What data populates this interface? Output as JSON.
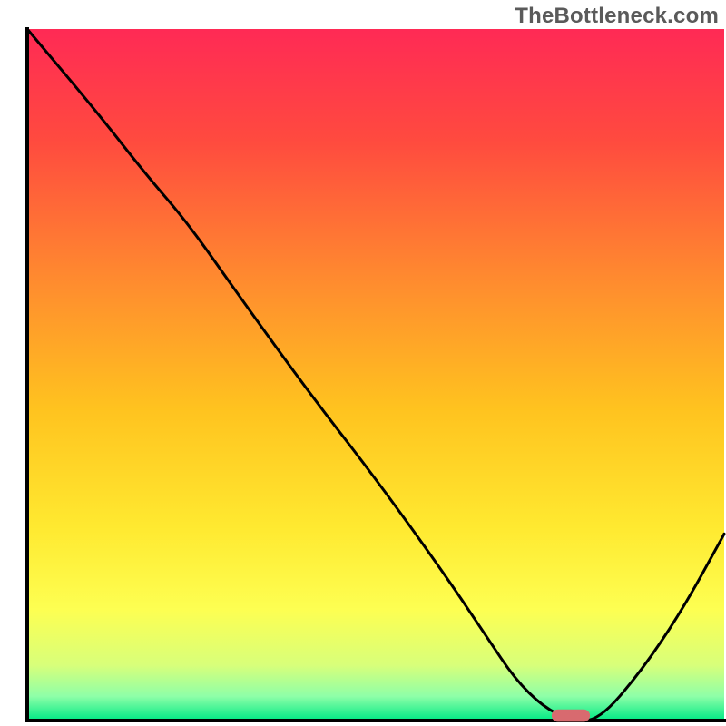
{
  "watermark": "TheBottleneck.com",
  "chart_data": {
    "type": "line",
    "title": "",
    "xlabel": "",
    "ylabel": "",
    "xlim": [
      0,
      100
    ],
    "ylim": [
      0,
      100
    ],
    "plot_background": {
      "type": "vertical-gradient",
      "stops": [
        {
          "offset": 0.0,
          "color": "#ff2a55"
        },
        {
          "offset": 0.16,
          "color": "#ff4a3f"
        },
        {
          "offset": 0.36,
          "color": "#ff8a2f"
        },
        {
          "offset": 0.55,
          "color": "#ffc31f"
        },
        {
          "offset": 0.72,
          "color": "#ffe930"
        },
        {
          "offset": 0.84,
          "color": "#fdff52"
        },
        {
          "offset": 0.92,
          "color": "#d8ff7a"
        },
        {
          "offset": 0.965,
          "color": "#8effa8"
        },
        {
          "offset": 1.0,
          "color": "#00e985"
        }
      ]
    },
    "series": [
      {
        "name": "bottleneck-curve",
        "color": "#000000",
        "stroke_width": 3,
        "x": [
          0,
          10,
          17,
          23,
          30,
          40,
          50,
          60,
          66,
          70,
          74,
          78,
          82,
          88,
          94,
          100
        ],
        "y": [
          100,
          88,
          79,
          72,
          62,
          48,
          35,
          21,
          12,
          6,
          2,
          0,
          0,
          7,
          16,
          27
        ]
      }
    ],
    "marker": {
      "name": "optimal-point",
      "shape": "rounded-rect",
      "cx": 78,
      "cy": 0,
      "width_frac": 0.055,
      "height_frac": 0.018,
      "color": "#d86a6f"
    },
    "axes": {
      "left": {
        "x": 3.5,
        "y0": 3.5,
        "y1": 100
      },
      "bottom": {
        "y": 100,
        "x0": 3.5,
        "x1": 100
      }
    }
  }
}
